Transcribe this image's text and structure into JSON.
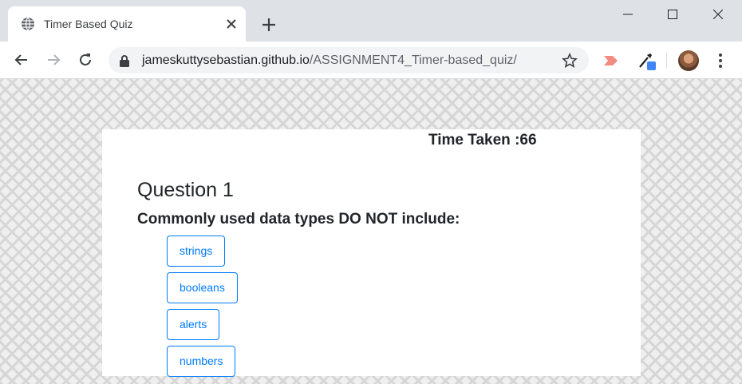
{
  "browser": {
    "tab": {
      "title": "Timer Based Quiz",
      "favicon": "globe-icon"
    },
    "address_bar": {
      "url_host": "jameskuttysebastian.github.io",
      "url_path": "/ASSIGNMENT4_Timer-based_quiz/"
    }
  },
  "quiz": {
    "timer_label": "Time Taken :",
    "timer_value": "66",
    "question_title": "Question 1",
    "question_text": "Commonly used data types DO NOT include:",
    "choices": [
      "strings",
      "booleans",
      "alerts",
      "numbers"
    ]
  }
}
